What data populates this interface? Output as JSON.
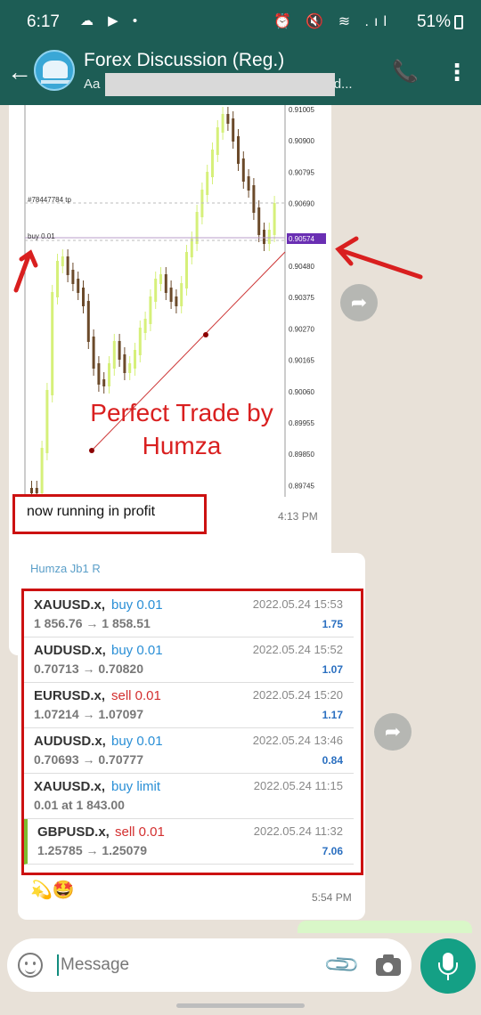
{
  "status_bar": {
    "time": "6:17",
    "left_icons": "☁ ▶ •",
    "right_icons": "⏰ 🔇 ≋ .ıl",
    "battery": "51%"
  },
  "header": {
    "title": "Forex Discussion (Reg.)",
    "subtitle_start": "Aa",
    "subtitle_end": "ed..."
  },
  "chart": {
    "price_ticks": [
      "0.91005",
      "0.90900",
      "0.90795",
      "0.90690",
      "0.90574",
      "0.90480",
      "0.90375",
      "0.90270",
      "0.90165",
      "0.90060",
      "0.89955",
      "0.89850",
      "0.89745"
    ],
    "current_price": "0.90574",
    "tp_label": "#78447784 tp",
    "buy_label": "buy 0.01",
    "overlay_line1": "Perfect Trade by",
    "overlay_line2": "Humza"
  },
  "message1": {
    "caption": "now running in profit",
    "time": "4:13 PM"
  },
  "message2": {
    "sender": "Humza Jb1 R",
    "trades": [
      {
        "symbol": "XAUUSD.x,",
        "side": "buy 0.01",
        "type": "buy",
        "prices": "1 856.76 → 1 858.51",
        "date": "2022.05.24 15:53",
        "profit": "1.75"
      },
      {
        "symbol": "AUDUSD.x,",
        "side": "buy 0.01",
        "type": "buy",
        "prices": "0.70713 → 0.70820",
        "date": "2022.05.24 15:52",
        "profit": "1.07"
      },
      {
        "symbol": "EURUSD.x,",
        "side": "sell 0.01",
        "type": "sell",
        "prices": "1.07214 → 1.07097",
        "date": "2022.05.24 15:20",
        "profit": "1.17"
      },
      {
        "symbol": "AUDUSD.x,",
        "side": "buy 0.01",
        "type": "buy",
        "prices": "0.70693 → 0.70777",
        "date": "2022.05.24 13:46",
        "profit": "0.84"
      },
      {
        "symbol": "XAUUSD.x,",
        "side": "buy limit",
        "type": "buy",
        "prices": "0.01 at 1 843.00",
        "date": "2022.05.24 11:15",
        "profit": ""
      },
      {
        "symbol": "GBPUSD.x,",
        "side": "sell 0.01",
        "type": "sell",
        "prices": "1.25785 → 1.25079",
        "date": "2022.05.24 11:32",
        "profit": "7.06"
      }
    ],
    "emojis": "💫🤩",
    "time": "5:54 PM"
  },
  "input": {
    "placeholder": "Message"
  },
  "colors": {
    "header": "#1d5d55",
    "buy": "#2a8fd6",
    "sell": "#d32f2f",
    "highlight_box": "#cc1111",
    "mic_button": "#14a085"
  }
}
